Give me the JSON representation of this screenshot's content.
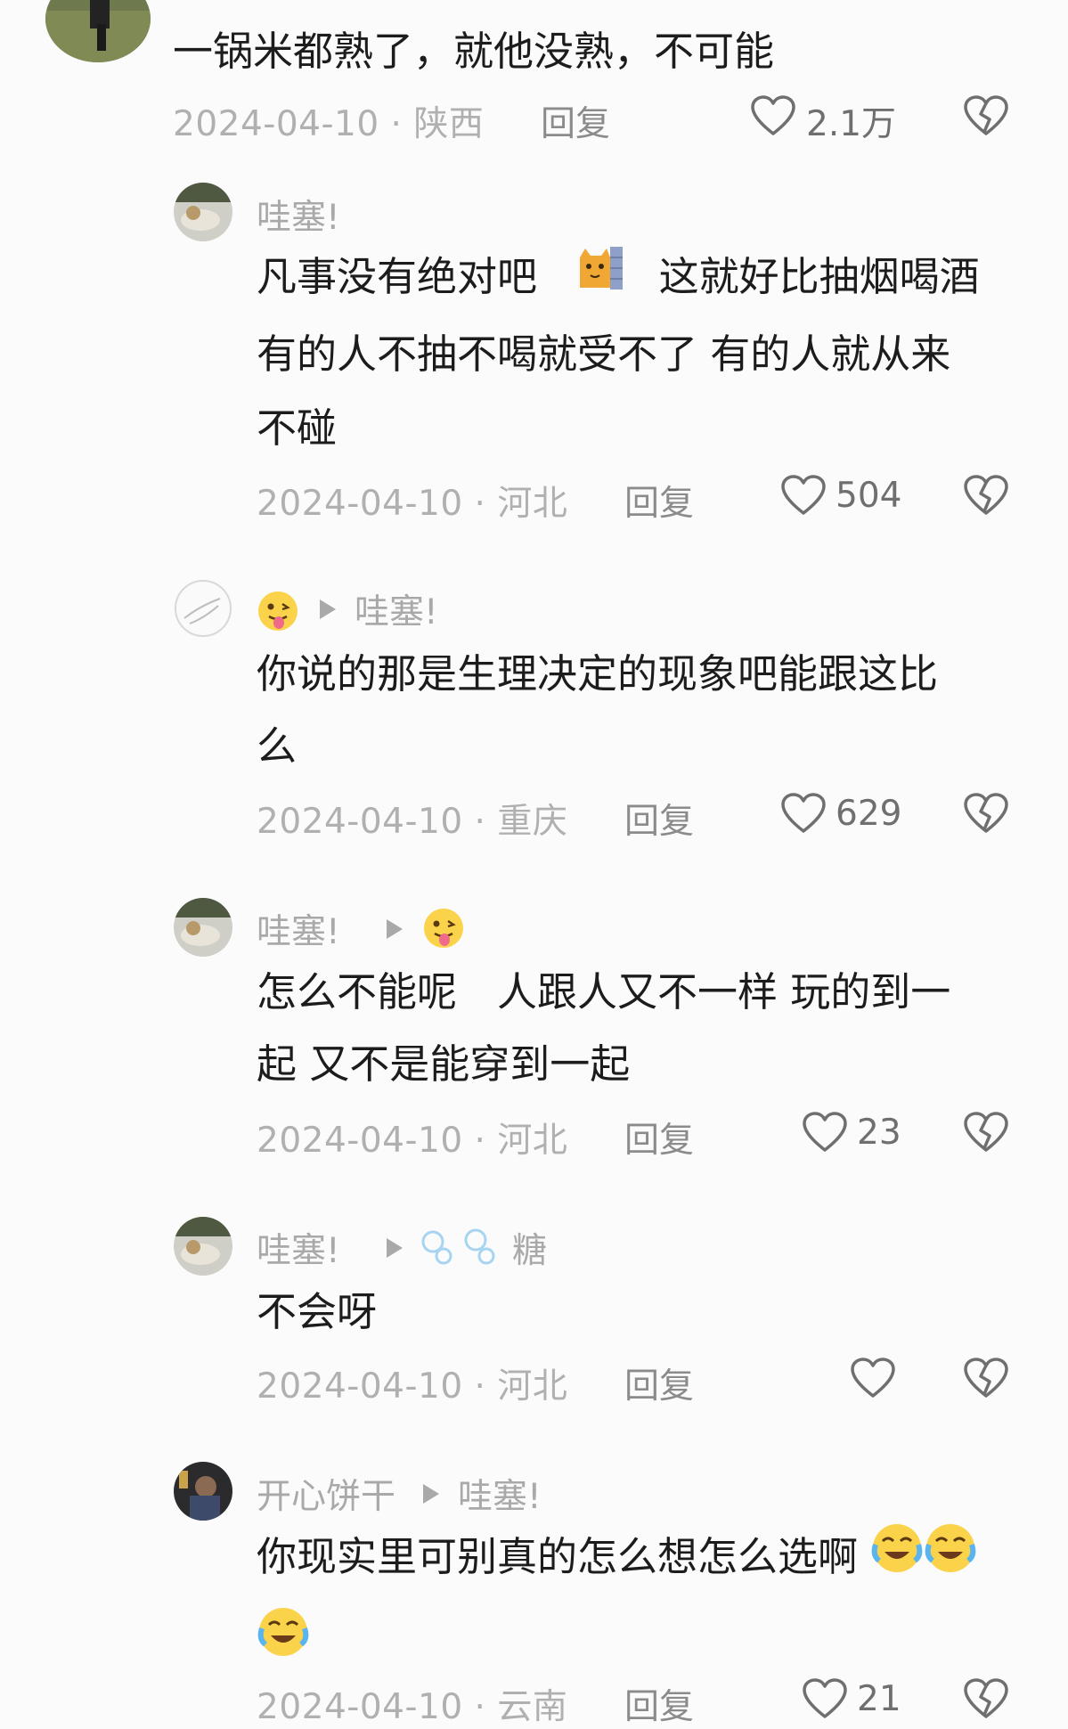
{
  "top_comment": {
    "text": "一锅米都熟了，就他没熟，不可能",
    "meta": "2024-04-10 · 陕西",
    "reply_label": "回复",
    "likes": "2.1万"
  },
  "replies": [
    {
      "author": "哇塞!",
      "line1": "凡事没有绝对吧",
      "line1b": "这就好比抽烟喝酒",
      "line2": "有的人不抽不喝就受不了 有的人就从来",
      "line3": "不碰",
      "meta": "2024-04-10 · 河北",
      "reply_label": "回复",
      "likes": "504"
    },
    {
      "reply_to": "哇塞!",
      "line1": "你说的那是生理决定的现象吧能跟这比",
      "line2": "么",
      "meta": "2024-04-10 · 重庆",
      "reply_label": "回复",
      "likes": "629"
    },
    {
      "author": "哇塞!",
      "line1": "怎么不能呢　人跟人又不一样 玩的到一",
      "line2": "起 又不是能穿到一起",
      "meta": "2024-04-10 · 河北",
      "reply_label": "回复",
      "likes": "23"
    },
    {
      "author": "哇塞!",
      "reply_to": "糖",
      "line1": "不会呀",
      "meta": "2024-04-10 · 河北",
      "reply_label": "回复",
      "likes": ""
    },
    {
      "author": "开心饼干",
      "reply_to": "哇塞!",
      "line1": "你现实里可别真的怎么想怎么选啊",
      "meta": "2024-04-10 · 云南",
      "reply_label": "回复",
      "likes": "21"
    }
  ],
  "icons": {
    "like": "heart-outline-icon",
    "dislike": "broken-heart-icon",
    "reply_arrow": "triangle-right-icon"
  }
}
